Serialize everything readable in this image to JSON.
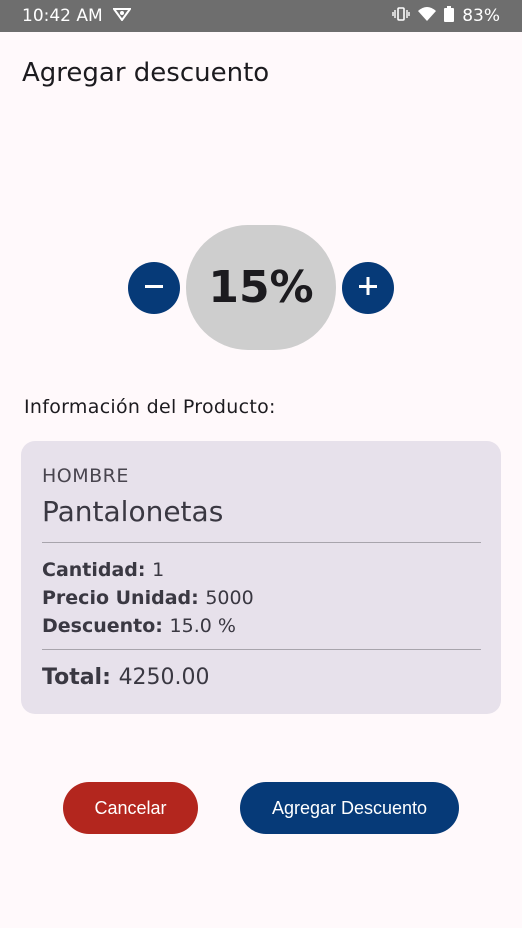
{
  "status_bar": {
    "time": "10:42 AM",
    "battery": "83%",
    "icons": [
      "vpn-icon",
      "vibrate-icon",
      "wifi-icon",
      "battery-icon"
    ]
  },
  "screen": {
    "title": "Agregar descuento"
  },
  "stepper": {
    "value": "15%",
    "minus_icon": "minus-icon",
    "plus_icon": "plus-icon"
  },
  "product": {
    "section_label": "Información del Producto:",
    "category": "HOMBRE",
    "name": "Pantalonetas",
    "quantity_label": "Cantidad:",
    "quantity_value": "1",
    "unit_price_label": "Precio Unidad:",
    "unit_price_value": "5000",
    "discount_label": "Descuento:",
    "discount_value": "15.0 %",
    "total_label": "Total:",
    "total_value": "4250.00"
  },
  "actions": {
    "cancel_label": "Cancelar",
    "add_label": "Agregar Descuento"
  },
  "colors": {
    "primary": "#063A78",
    "cancel": "#B3261E",
    "card": "#E7E1EB",
    "pill": "#CECECE",
    "status_bar": "#6E6E6E"
  }
}
